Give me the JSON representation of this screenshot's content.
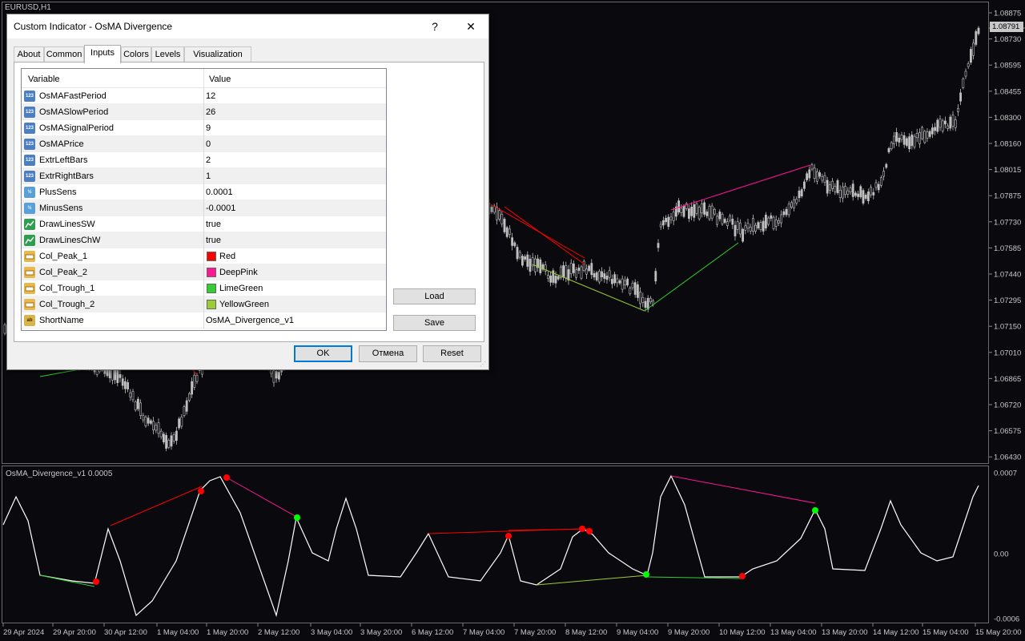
{
  "chart": {
    "symbol": "EURUSD,H1",
    "current_price": "1.08791",
    "price_ticks": [
      "1.08875",
      "1.08730",
      "1.08595",
      "1.08455",
      "1.08300",
      "1.08160",
      "1.08015",
      "1.07875",
      "1.07730",
      "1.07585",
      "1.07440",
      "1.07295",
      "1.07150",
      "1.07010",
      "1.06865",
      "1.06720",
      "1.06575",
      "1.06430"
    ],
    "indicator_label": "OsMA_Divergence_v1 0.0005",
    "indicator_ticks": [
      "0.0007",
      "0.00",
      "-0.0006"
    ],
    "time_ticks": [
      "29 Apr 2024",
      "29 Apr 20:00",
      "30 Apr 12:00",
      "1 May 04:00",
      "1 May 20:00",
      "2 May 12:00",
      "3 May 04:00",
      "3 May 20:00",
      "6 May 12:00",
      "7 May 04:00",
      "7 May 20:00",
      "8 May 12:00",
      "9 May 04:00",
      "9 May 20:00",
      "10 May 12:00",
      "13 May 04:00",
      "13 May 20:00",
      "14 May 12:00",
      "15 May 04:00",
      "15 May 20:00"
    ],
    "colors": {
      "background": "#0a0a0e",
      "candle": "#c0c0c0",
      "osma_line": "#ffffff",
      "peak_1": "#ff0000",
      "peak_2": "#ff1493",
      "trough_1": "#32cd32",
      "trough_2": "#9acd32",
      "peak_dot": "#ff0000",
      "trough_dot": "#00ff00"
    }
  },
  "dialog": {
    "title": "Custom Indicator - OsMA Divergence",
    "help_label": "?",
    "close_label": "✕",
    "tabs": [
      {
        "label": "About"
      },
      {
        "label": "Common"
      },
      {
        "label": "Inputs",
        "active": true
      },
      {
        "label": "Colors"
      },
      {
        "label": "Levels"
      },
      {
        "label": "Visualization"
      }
    ],
    "grid": {
      "header_variable": "Variable",
      "header_value": "Value",
      "rows": [
        {
          "icon": "integer-icon",
          "icon_text": "123",
          "name": "OsMAFastPeriod",
          "value": "12"
        },
        {
          "icon": "integer-icon",
          "icon_text": "123",
          "name": "OsMASlowPeriod",
          "value": "26"
        },
        {
          "icon": "integer-icon",
          "icon_text": "123",
          "name": "OsMASignalPeriod",
          "value": "9"
        },
        {
          "icon": "integer-icon",
          "icon_text": "123",
          "name": "OsMAPrice",
          "value": "0"
        },
        {
          "icon": "integer-icon",
          "icon_text": "123",
          "name": "ExtrLeftBars",
          "value": "2"
        },
        {
          "icon": "integer-icon",
          "icon_text": "123",
          "name": "ExtrRightBars",
          "value": "1"
        },
        {
          "icon": "double-icon",
          "icon_text": "½",
          "name": "PlusSens",
          "value": "0.0001"
        },
        {
          "icon": "double-icon",
          "icon_text": "½",
          "name": "MinusSens",
          "value": "-0.0001"
        },
        {
          "icon": "bool-icon",
          "icon_text": "",
          "name": "DrawLinesSW",
          "value": "true"
        },
        {
          "icon": "bool-icon",
          "icon_text": "",
          "name": "DrawLinesChW",
          "value": "true"
        },
        {
          "icon": "color-icon",
          "icon_text": "",
          "name": "Col_Peak_1",
          "value": "Red",
          "swatch": "#ff0000"
        },
        {
          "icon": "color-icon",
          "icon_text": "",
          "name": "Col_Peak_2",
          "value": "DeepPink",
          "swatch": "#ff1493"
        },
        {
          "icon": "color-icon",
          "icon_text": "",
          "name": "Col_Trough_1",
          "value": "LimeGreen",
          "swatch": "#32cd32"
        },
        {
          "icon": "color-icon",
          "icon_text": "",
          "name": "Col_Trough_2",
          "value": "YellowGreen",
          "swatch": "#9acd32"
        },
        {
          "icon": "string-icon",
          "icon_text": "ab",
          "name": "ShortName",
          "value": "OsMA_Divergence_v1"
        }
      ]
    },
    "buttons": {
      "load": "Load",
      "save": "Save",
      "ok": "OK",
      "cancel": "Отмена",
      "reset": "Reset"
    }
  }
}
